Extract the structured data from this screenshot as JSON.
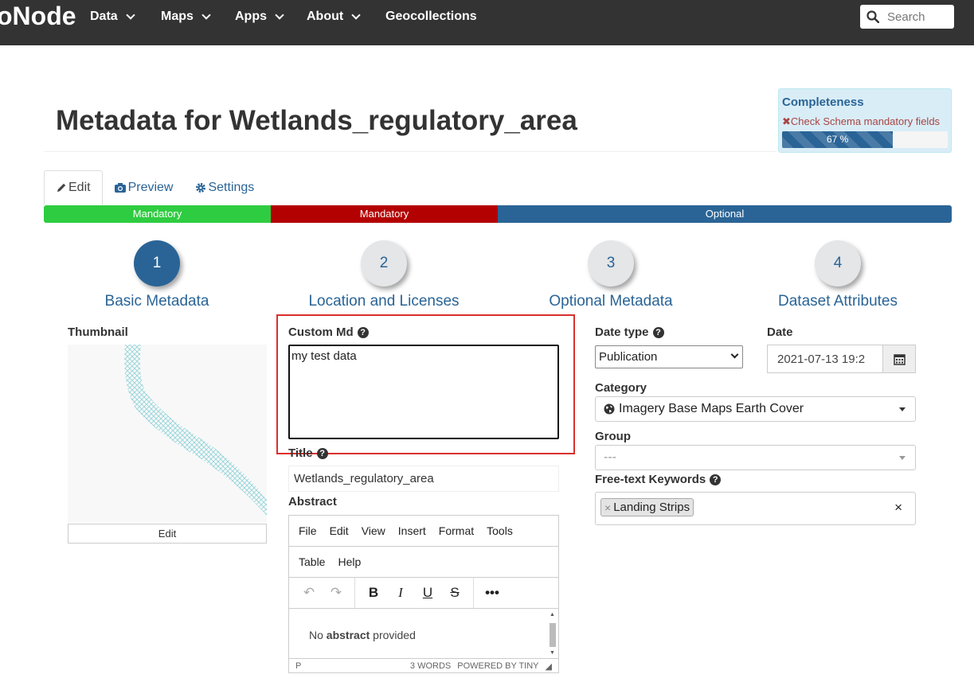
{
  "navbar": {
    "brand": "oNode",
    "items": [
      {
        "label": "Data",
        "dropdown": true
      },
      {
        "label": "Maps",
        "dropdown": true
      },
      {
        "label": "Apps",
        "dropdown": true
      },
      {
        "label": "About",
        "dropdown": true
      },
      {
        "label": "Geocollections",
        "dropdown": false
      }
    ],
    "search_placeholder": "Search"
  },
  "page": {
    "title": "Metadata for Wetlands_regulatory_area"
  },
  "completeness": {
    "title": "Completeness",
    "warning": "Check Schema mandatory fields",
    "percent_label": "67 %",
    "percent": 67
  },
  "tabs": [
    {
      "label": "Edit",
      "icon": "pencil-icon",
      "active": true
    },
    {
      "label": "Preview",
      "icon": "camera-icon",
      "active": false
    },
    {
      "label": "Settings",
      "icon": "gear-icon",
      "active": false
    }
  ],
  "stepbar": [
    {
      "label": "Mandatory",
      "color": "#2ecc40"
    },
    {
      "label": "Mandatory",
      "color": "#b30000"
    },
    {
      "label": "Optional",
      "color": "#2a6496"
    }
  ],
  "steps": [
    {
      "number": "1",
      "label": "Basic Metadata",
      "active": true
    },
    {
      "number": "2",
      "label": "Location and Licenses",
      "active": false
    },
    {
      "number": "3",
      "label": "Optional Metadata",
      "active": false
    },
    {
      "number": "4",
      "label": "Dataset Attributes",
      "active": false
    }
  ],
  "thumbnail": {
    "label": "Thumbnail",
    "edit_label": "Edit"
  },
  "custom_md": {
    "label": "Custom Md",
    "value": "my test data"
  },
  "title_field": {
    "label": "Title",
    "value": "Wetlands_regulatory_area"
  },
  "abstract": {
    "label": "Abstract",
    "menus": [
      "File",
      "Edit",
      "View",
      "Insert",
      "Format",
      "Tools",
      "Table",
      "Help"
    ],
    "content_prefix": "No ",
    "content_bold": "abstract",
    "content_suffix": " provided",
    "status_path": "P",
    "word_count": "3 WORDS",
    "powered_by": "POWERED BY TINY"
  },
  "date_type": {
    "label": "Date type",
    "selected": "Publication"
  },
  "date": {
    "label": "Date",
    "value": "2021-07-13 19:2"
  },
  "category": {
    "label": "Category",
    "selected": "Imagery Base Maps Earth Cover"
  },
  "group": {
    "label": "Group",
    "selected": "---"
  },
  "keywords": {
    "label": "Free-text Keywords",
    "tags": [
      "Landing Strips"
    ]
  },
  "colors": {
    "navbar": "#333333",
    "link": "#2a6496",
    "highlight": "#d9302c"
  }
}
